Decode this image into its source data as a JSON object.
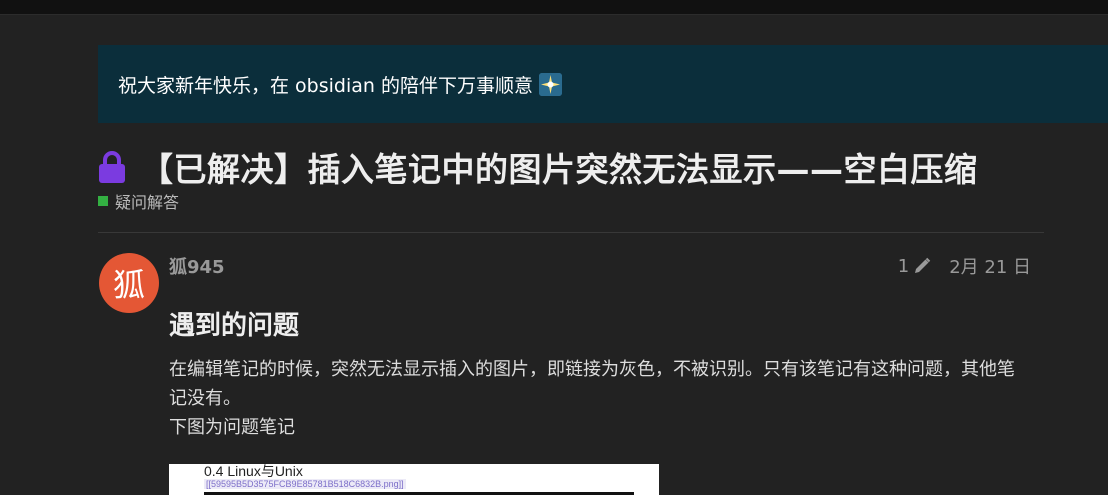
{
  "banner": {
    "text": "祝大家新年快乐，在 obsidian 的陪伴下万事顺意",
    "icon": "sparkle-icon"
  },
  "topic": {
    "title": "【已解决】插入笔记中的图片突然无法显示——空白压缩",
    "locked": true,
    "category": {
      "name": "疑问解答",
      "color": "#33b042"
    }
  },
  "post": {
    "author": {
      "avatar_char": "狐",
      "avatar_color": "#e45735",
      "username": "狐945"
    },
    "edit_count": "1",
    "date": "2月 21 日",
    "heading": "遇到的问题",
    "paragraphs": [
      "在编辑笔记的时候，突然无法显示插入的图片，即链接为灰色，不被识别。只有该笔记有这种问题，其他笔记没有。",
      "下图为问题笔记"
    ],
    "image": {
      "title": "0.4 Linux与Unix",
      "link": "[[59595B5D3575FCB9E85781B518C6832B.png]]"
    }
  },
  "colors": {
    "background": "#222222",
    "banner_bg": "#0b2e3b",
    "lock": "#7b3be0"
  }
}
